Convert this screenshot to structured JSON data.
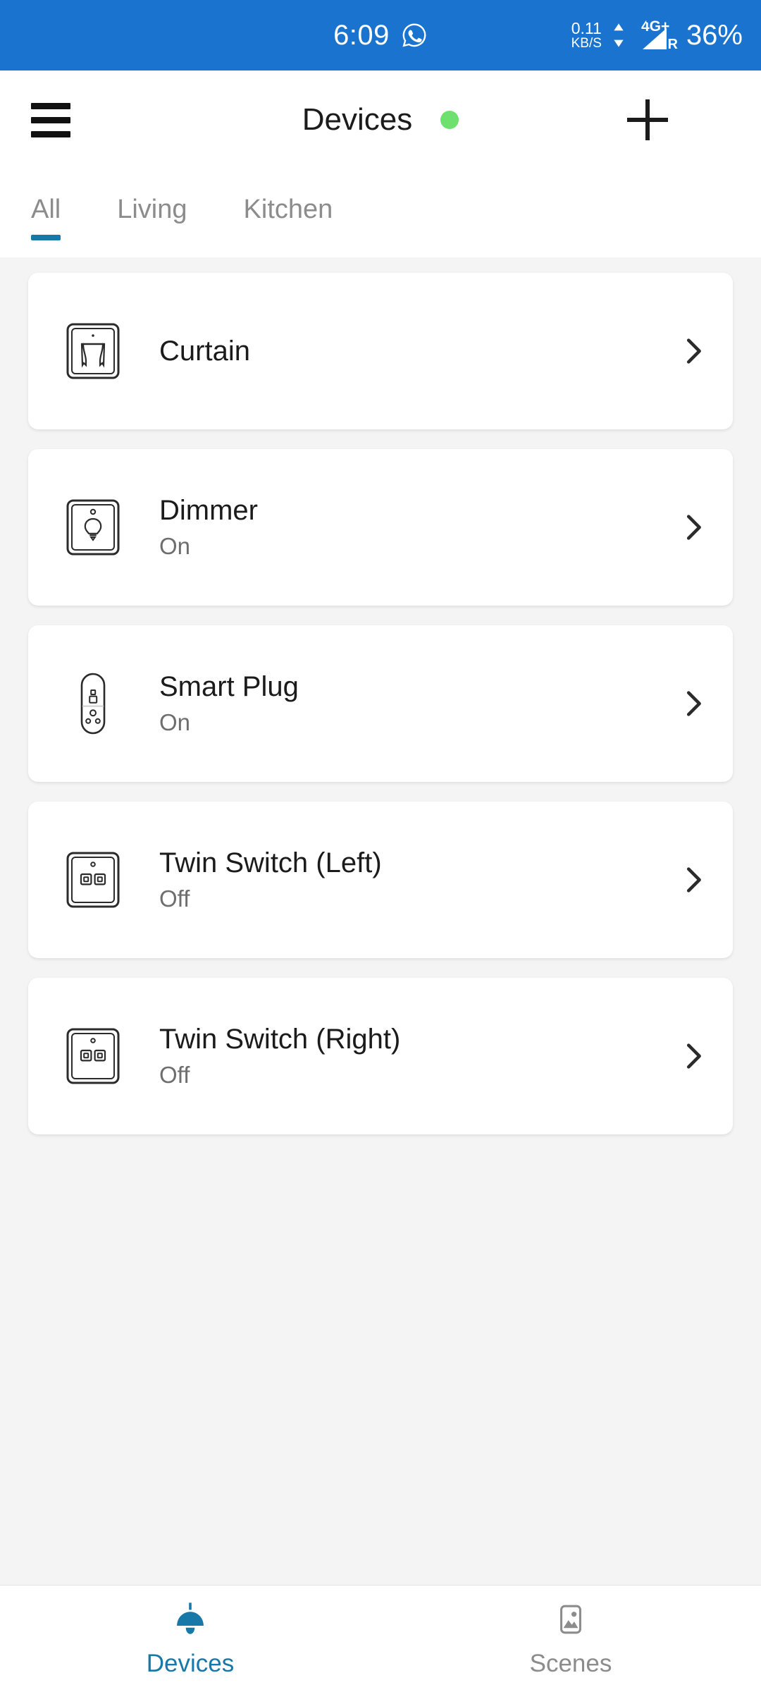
{
  "statusbar": {
    "clock": "6:09",
    "whatsapp_icon": "whatsapp-icon",
    "net_speed_value": "0.11",
    "net_speed_unit": "KB/S",
    "network_type": "4G",
    "network_plus": "+",
    "roaming": "R",
    "battery": "36%",
    "bg_color": "#1a74cf"
  },
  "header": {
    "menu_icon": "hamburger-menu-icon",
    "title": "Devices",
    "status_dot_color": "#6ee06e",
    "add_icon": "plus-icon"
  },
  "tabs": {
    "items": [
      {
        "label": "All",
        "active": true
      },
      {
        "label": "Living",
        "active": false
      },
      {
        "label": "Kitchen",
        "active": false
      }
    ],
    "indicator_color": "#1878a8"
  },
  "devices": [
    {
      "name": "Curtain",
      "status": "",
      "icon": "curtain-panel-icon"
    },
    {
      "name": "Dimmer",
      "status": "On",
      "icon": "dimmer-bulb-panel-icon"
    },
    {
      "name": "Smart Plug",
      "status": "On",
      "icon": "smart-plug-icon"
    },
    {
      "name": "Twin Switch (Left)",
      "status": "Off",
      "icon": "twin-switch-panel-icon"
    },
    {
      "name": "Twin Switch (Right)",
      "status": "Off",
      "icon": "twin-switch-panel-icon"
    }
  ],
  "bottomnav": {
    "items": [
      {
        "label": "Devices",
        "icon": "pendant-lamp-icon",
        "active": true
      },
      {
        "label": "Scenes",
        "icon": "image-picture-icon",
        "active": false
      }
    ],
    "active_color": "#1878a8",
    "inactive_color": "#8c8c8c"
  }
}
